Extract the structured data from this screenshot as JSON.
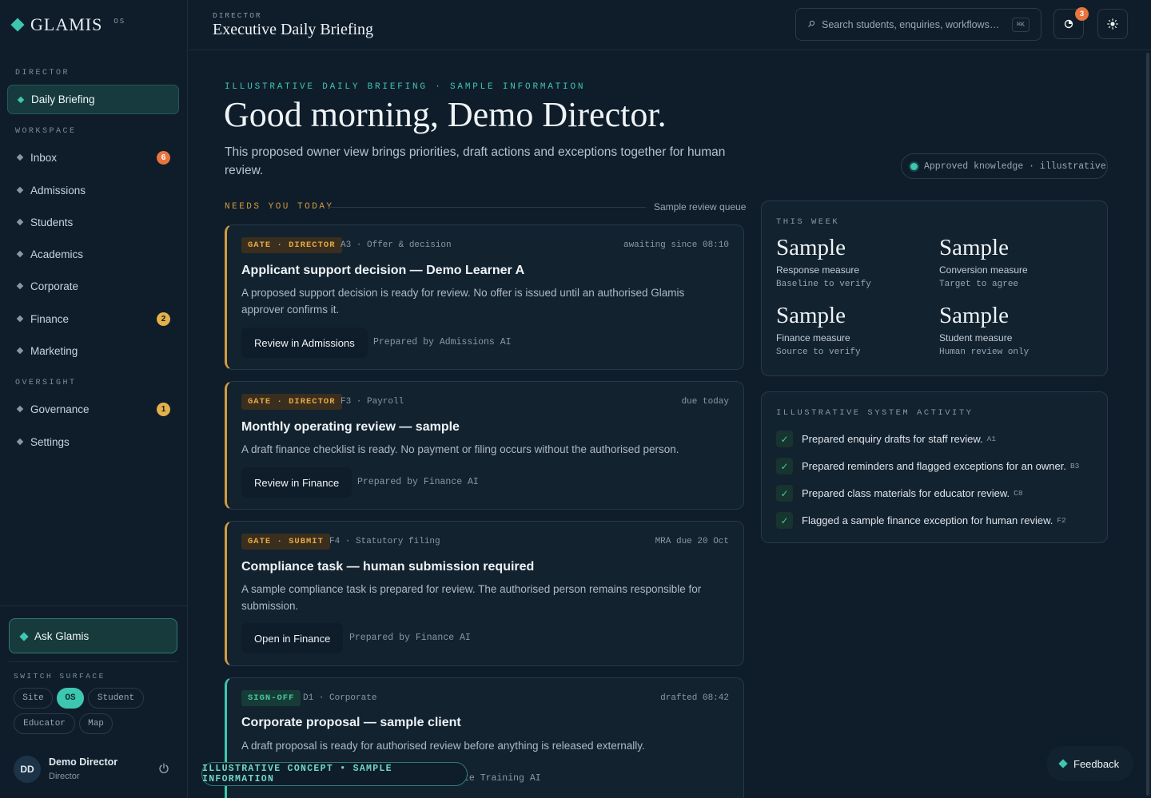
{
  "brand": {
    "name": "GLAMIS",
    "suffix": "OS"
  },
  "sidebar": {
    "section_director": "DIRECTOR",
    "section_workspace": "WORKSPACE",
    "section_oversight": "OVERSIGHT",
    "daily_briefing": "Daily Briefing",
    "inbox": {
      "label": "Inbox",
      "badge": "6"
    },
    "admissions": "Admissions",
    "students": "Students",
    "academics": "Academics",
    "corporate": "Corporate",
    "finance": {
      "label": "Finance",
      "badge": "2"
    },
    "marketing": "Marketing",
    "governance": {
      "label": "Governance",
      "badge": "1"
    },
    "settings": "Settings",
    "ask": "Ask Glamis",
    "switch_label": "SWITCH SURFACE",
    "surfaces": {
      "site": "Site",
      "os": "OS",
      "student": "Student",
      "educator": "Educator",
      "map": "Map"
    },
    "user": {
      "initials": "DD",
      "name": "Demo Director",
      "role": "Director"
    }
  },
  "header": {
    "eyebrow": "DIRECTOR",
    "title": "Executive Daily Briefing",
    "search_placeholder": "Search students, enquiries, workflows…",
    "search_kbd": "⌘K",
    "notifications_badge": "3"
  },
  "hero": {
    "eyebrow": "ILLUSTRATIVE DAILY BRIEFING · SAMPLE INFORMATION",
    "title": "Good morning, Demo Director.",
    "subtitle": "This proposed owner view brings priorities, draft actions and exceptions together for human review.",
    "knowledge_pill": "Approved knowledge · illustrative"
  },
  "needs": {
    "label": "NEEDS YOU TODAY",
    "queue": "Sample review queue"
  },
  "cards": [
    {
      "gate": "GATE · DIRECTOR",
      "meta": "A3 · Offer & decision",
      "right": "awaiting since 08:10",
      "title": "Applicant support decision — Demo Learner A",
      "desc": "A proposed support decision is ready for review. No offer is issued until an authorised Glamis approver confirms it.",
      "button": "Review in Admissions",
      "prepared": "Prepared by Admissions AI"
    },
    {
      "gate": "GATE · DIRECTOR",
      "meta": "F3 · Payroll",
      "right": "due today",
      "title": "Monthly operating review — sample",
      "desc": "A draft finance checklist is ready. No payment or filing occurs without the authorised person.",
      "button": "Review in Finance",
      "prepared": "Prepared by Finance AI"
    },
    {
      "gate": "GATE · SUBMIT",
      "meta": "F4 · Statutory filing",
      "right": "MRA due 20 Oct",
      "title": "Compliance task — human submission required",
      "desc": "A sample compliance task is prepared for review. The authorised person remains responsible for submission.",
      "button": "Open in Finance",
      "prepared": "Prepared by Finance AI"
    },
    {
      "gate": "SIGN-OFF",
      "meta": "D1 · Corporate",
      "right": "drafted 08:42",
      "title": "Corporate proposal — sample client",
      "desc": "A draft proposal is ready for authorised review before anything is released externally.",
      "prepared_partial": "te Training AI"
    }
  ],
  "week": {
    "label": "THIS WEEK",
    "stats": [
      {
        "big": "Sample",
        "name": "Response measure",
        "note": "Baseline to verify"
      },
      {
        "big": "Sample",
        "name": "Conversion measure",
        "note": "Target to agree"
      },
      {
        "big": "Sample",
        "name": "Finance measure",
        "note": "Source to verify"
      },
      {
        "big": "Sample",
        "name": "Student measure",
        "note": "Human review only"
      }
    ]
  },
  "activity": {
    "label": "ILLUSTRATIVE SYSTEM ACTIVITY",
    "items": [
      {
        "text": "Prepared enquiry drafts for staff review.",
        "code": "A1"
      },
      {
        "text": "Prepared reminders and flagged exceptions for an owner.",
        "code": "B3"
      },
      {
        "text": "Prepared class materials for educator review.",
        "code": "C8"
      },
      {
        "text": "Flagged a sample finance exception for human review.",
        "code": "F2"
      }
    ]
  },
  "concept_pill": "ILLUSTRATIVE CONCEPT • SAMPLE INFORMATION",
  "feedback": "Feedback"
}
